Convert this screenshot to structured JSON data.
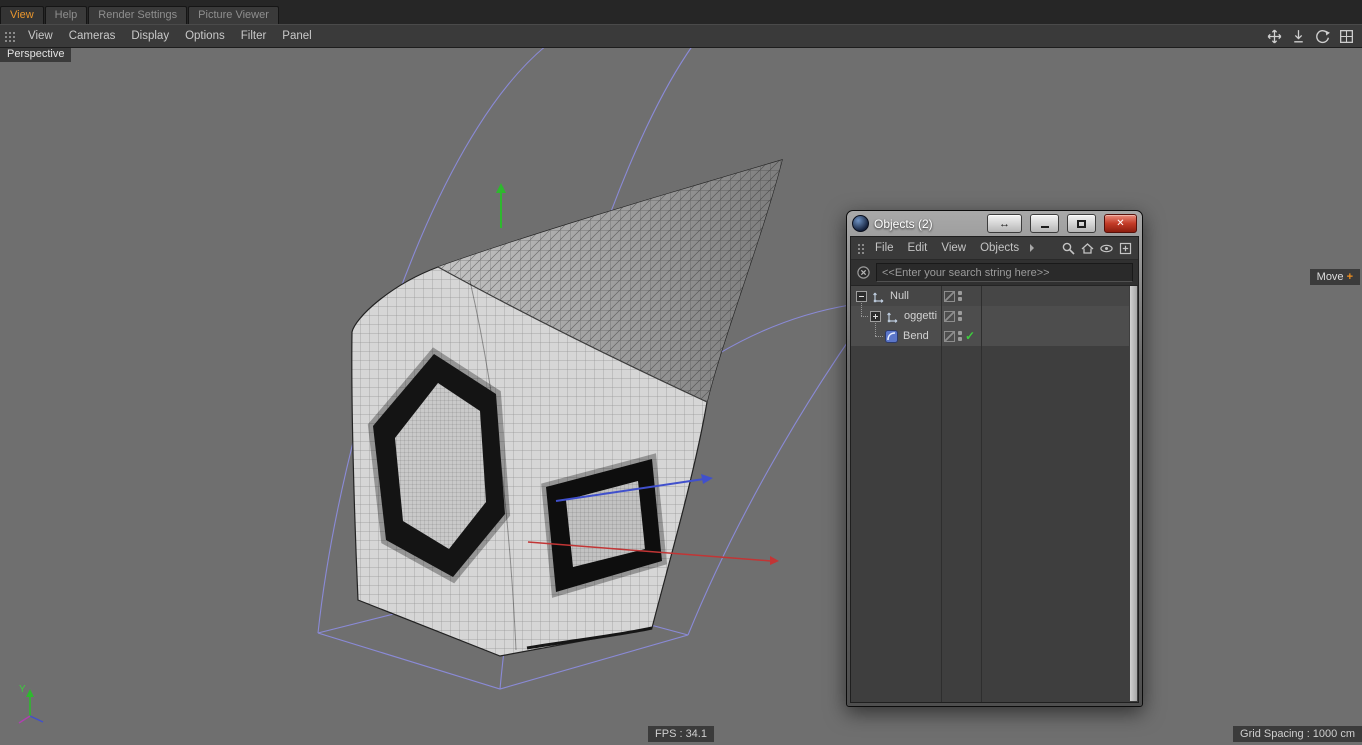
{
  "titlebar": {
    "tabs": [
      {
        "label": "View",
        "active": true
      },
      {
        "label": "Help",
        "active": false
      },
      {
        "label": "Render Settings",
        "active": false
      },
      {
        "label": "Picture Viewer",
        "active": false
      }
    ]
  },
  "menubar": {
    "items": [
      "View",
      "Cameras",
      "Display",
      "Options",
      "Filter",
      "Panel"
    ]
  },
  "viewport": {
    "view_label": "Perspective",
    "tool_hint": "Move",
    "tool_hint_plus": "+",
    "fps": "FPS : 34.1",
    "grid_spacing": "Grid Spacing : 1000 cm",
    "axis_label": "Y"
  },
  "objects_window": {
    "title": "Objects (2)",
    "window_buttons": {
      "dock": "↔",
      "close": "✕"
    },
    "menu_items": [
      "File",
      "Edit",
      "View",
      "Objects"
    ],
    "search_placeholder": "<<Enter your search string here>>",
    "tree": [
      {
        "name": "Null"
      },
      {
        "name": "oggetti"
      },
      {
        "name": "Bend"
      }
    ],
    "bend_check": "✓"
  },
  "colors": {
    "accent_orange": "#e8962e",
    "cage_purple": "#8c8cdd",
    "axis_green": "#2eb82e",
    "axis_red": "#c23535",
    "axis_blue": "#4050cc",
    "check_green": "#3ecc3e"
  }
}
